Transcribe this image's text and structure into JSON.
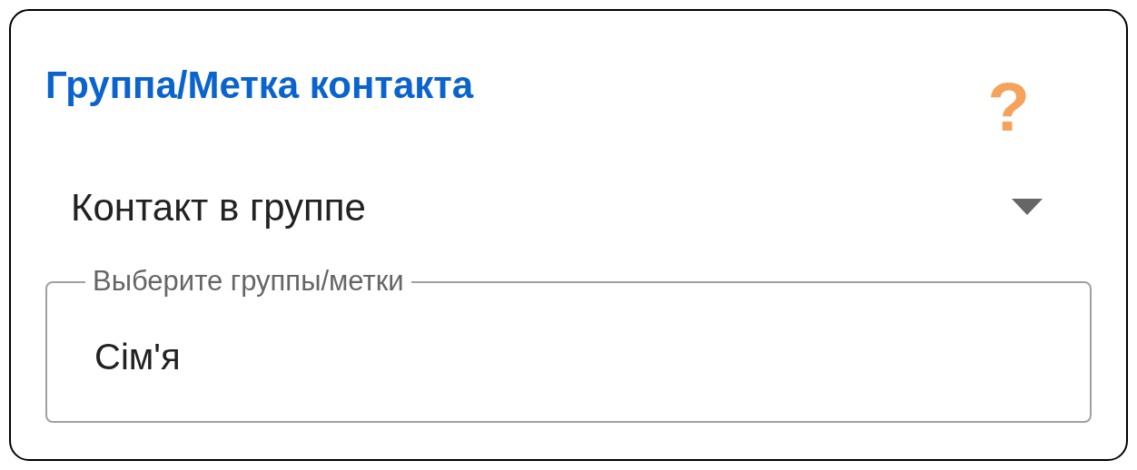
{
  "title": "Группа/Метка контакта",
  "help": "?",
  "select": {
    "value": "Контакт в группе"
  },
  "groups_field": {
    "label": "Выберите группы/метки",
    "value": "Сім'я"
  }
}
